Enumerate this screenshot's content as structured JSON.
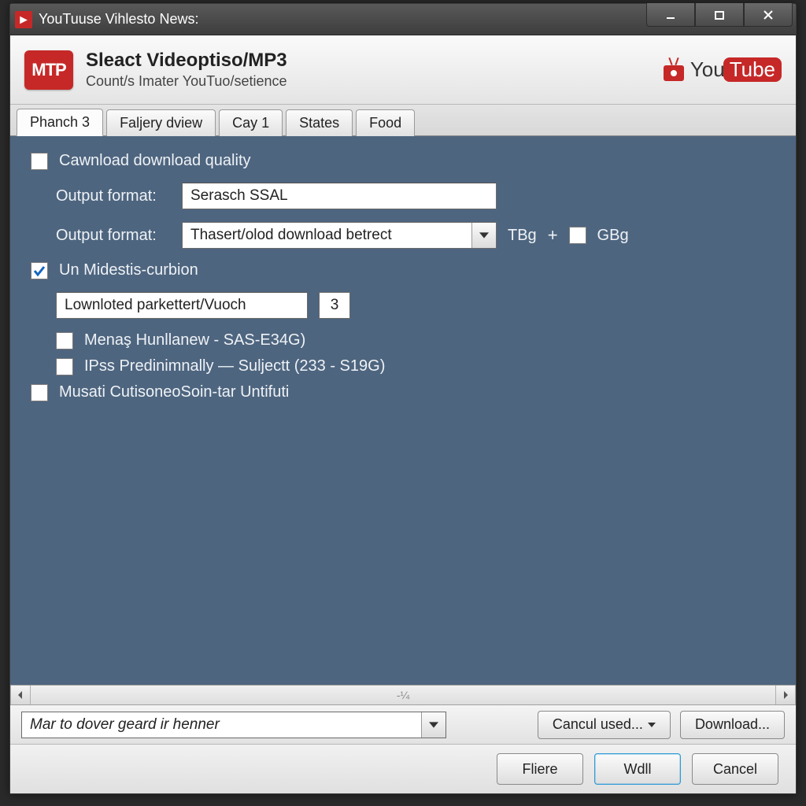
{
  "window_title": "YouTuuse Vihlesto News:",
  "titlebar_icon_text": "▶",
  "header": {
    "badge": "MTP",
    "title": "Sleact Videoptiso/MP3",
    "subtitle": "Count/s Imater YouTuo/setience",
    "logo_you": "You",
    "logo_tube": "Tube"
  },
  "tabs": [
    {
      "label": "Phanch 3",
      "active": true
    },
    {
      "label": "Faljery dview",
      "active": false
    },
    {
      "label": "Cay 1",
      "active": false
    },
    {
      "label": "States",
      "active": false
    },
    {
      "label": "Food",
      "active": false
    }
  ],
  "main": {
    "quality_checkbox": {
      "checked": false,
      "label": "Cawnload download quality"
    },
    "row1": {
      "label": "Output format:",
      "value": "Serasch SSAL"
    },
    "row2": {
      "label": "Output format:",
      "combo_value": "Thasert/olod download betrect",
      "after1": "TBg",
      "plus": "+",
      "gb_checked": false,
      "after2": "GBg"
    },
    "suboption": {
      "checked": true,
      "label": "Un Midestis-curbion"
    },
    "sub_input_value": "Lownloted parkettert/Vuoch",
    "sub_num": "3",
    "opt1": {
      "checked": false,
      "label": "Menaş Hunllanew - SAS-E34G)"
    },
    "opt2": {
      "checked": false,
      "label": "IPss Predinimnally — Suljectt (233 - S19G)"
    },
    "opt3": {
      "checked": false,
      "label": "Musati CutisoneoSoin-tar Untifuti"
    }
  },
  "hscroll_text": "-¼",
  "strip": {
    "combo_value": "Mar to dover geard ir henner",
    "used_btn": "Cancul used...",
    "download_btn": "Download..."
  },
  "footer": {
    "btn1": "Fliere",
    "btn2": "Wdll",
    "btn3": "Cancel"
  }
}
